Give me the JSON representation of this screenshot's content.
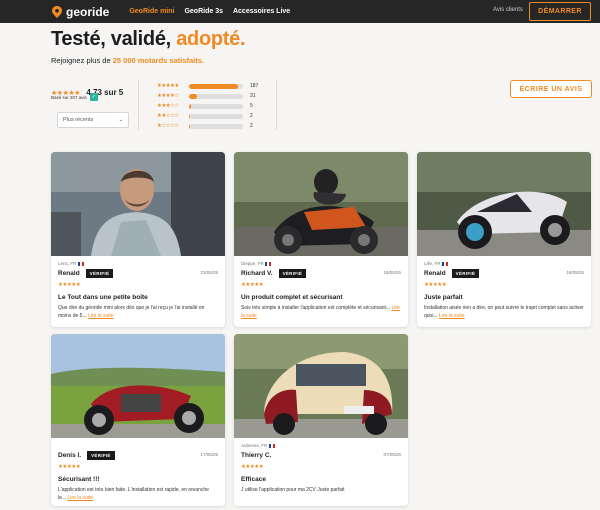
{
  "nav": {
    "logo": "georide",
    "links": [
      "GeoRide mini",
      "GeoRide 3s",
      "Accessoires Live"
    ],
    "clients": "Avis clients",
    "cta": "DÉMARRER"
  },
  "hero": {
    "title_part1": "Testé, validé, ",
    "title_highlight": "adopté.",
    "sub_part1": "Rejoignez plus de ",
    "sub_highlight": "25 000 motards satisfaits."
  },
  "rating": {
    "stars": "★★★★★",
    "average": "4.73 sur 5",
    "based_on": "Basé sur 207 avis",
    "sort_label": "Plus récents",
    "histogram": [
      {
        "stars": "★★★★★",
        "count": "187",
        "fraction": 0.9
      },
      {
        "stars": "★★★★☆",
        "count": "31",
        "fraction": 0.15
      },
      {
        "stars": "★★★☆☆",
        "count": "5",
        "fraction": 0.03
      },
      {
        "stars": "★★☆☆☆",
        "count": "2",
        "fraction": 0.01
      },
      {
        "stars": "★☆☆☆☆",
        "count": "2",
        "fraction": 0.01
      }
    ],
    "write_review": "ÉCRIRE UN AVIS"
  },
  "reviews": [
    {
      "location": "Lens, FR",
      "name": "Renald",
      "badge": "VÉRIFIÉ",
      "date": "23/05/25",
      "stars": "★★★★★",
      "title": "Le Tout dans une petite boîte",
      "body": "Que dire du géoride mini alors dès que je l'ai reçu je l'ai installé en moins de 5...",
      "more": "Lire la suite"
    },
    {
      "location": "Dieppe, FR",
      "name": "Richard V.",
      "badge": "VÉRIFIÉ",
      "date": "18/05/25",
      "stars": "★★★★★",
      "title": "Un produit complet et sécurisant",
      "body": "Sois très simple à installer l'application est complète et sécurisant...",
      "more": "Lire la suite"
    },
    {
      "location": "Lille, FR",
      "name": "Renald",
      "badge": "VÉRIFIÉ",
      "date": "18/05/25",
      "stars": "★★★★★",
      "title": "Juste parfait",
      "body": "Installation aisée rien a dire, on peut suivre le trajet complet sans activer quoi...",
      "more": "Lire la suite"
    },
    {
      "location": "",
      "name": "Denis I.",
      "badge": "VÉRIFIÉ",
      "date": "17/05/25",
      "stars": "★★★★★",
      "title": "Sécurisant !!!",
      "body": "L'application est très bien faite. L'installation est rapide, en revanche le...",
      "more": "Lire la suite"
    },
    {
      "location": "Aubenas, FR",
      "name": "Thierry C.",
      "badge": "",
      "date": "07/05/25",
      "stars": "★★★★★",
      "title": "Efficace",
      "body": "J utilise l'application pour ma 2CV Juste parfait",
      "more": ""
    }
  ]
}
